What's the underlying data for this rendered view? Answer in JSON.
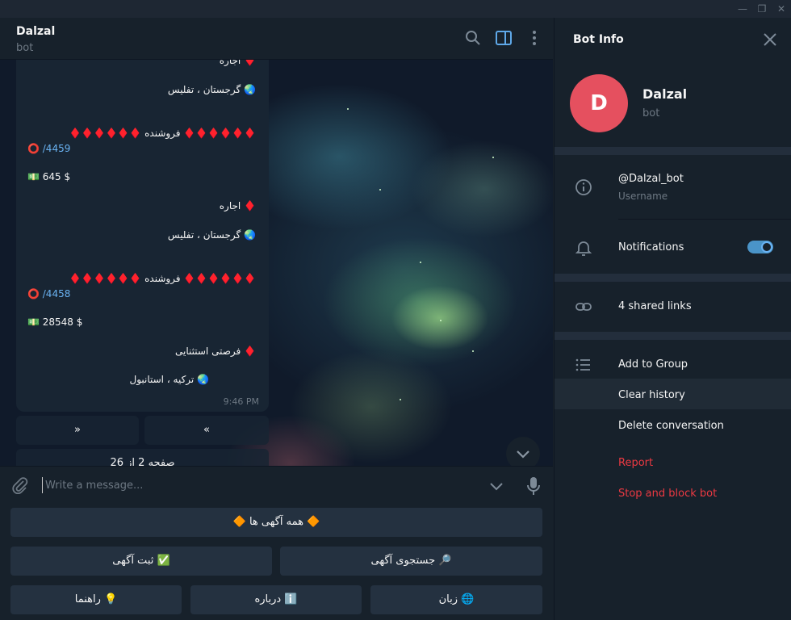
{
  "window": {
    "min": "—",
    "max": "❐",
    "close": "✕"
  },
  "chat": {
    "title": "Dalzal",
    "status": "bot",
    "messages": {
      "line_top": "♦️ اجاره",
      "loc1": "🌏 گرجستان ، تفلیس",
      "seller1": "♦️♦️♦️♦️♦️♦️ فروشنده ♦️♦️♦️♦️♦️♦️",
      "id1": "/4459",
      "price1": "💵 645 $",
      "type2": "♦️ اجاره",
      "loc2": "🌏 گرجستان ، تفلیس",
      "seller2": "♦️♦️♦️♦️♦️♦️ فروشنده ♦️♦️♦️♦️♦️♦️",
      "id2": "/4458",
      "price2": "💵 28548 $",
      "type3": "♦️ فرصتی استثنایی",
      "loc3": "🌏 ترکیه ، استانبول",
      "time": "9:46 PM"
    },
    "inline_kb": {
      "prev": "«",
      "next": "»",
      "page": "صفحه 2 از 26"
    },
    "composer": {
      "placeholder": "Write a message..."
    },
    "keyboard": {
      "all_ads": "🔶 همه آگهی ها 🔶",
      "submit_ad": "✅ ثبت آگهی",
      "search_ad": "🔎 جستجوی آگهی",
      "guide": "💡 راهنما",
      "about": "ℹ️ درباره",
      "language": "🌐 زبان"
    }
  },
  "info": {
    "title": "Bot Info",
    "avatar_letter": "D",
    "avatar_color": "#e5505f",
    "name": "Dalzal",
    "sub": "bot",
    "username": "@Dalzal_bot",
    "username_label": "Username",
    "notifications": "Notifications",
    "notifications_on": true,
    "shared_links": "4 shared links",
    "add_to_group": "Add to Group",
    "clear_history": "Clear history",
    "delete_conversation": "Delete conversation",
    "report": "Report",
    "stop_block": "Stop and block bot"
  }
}
